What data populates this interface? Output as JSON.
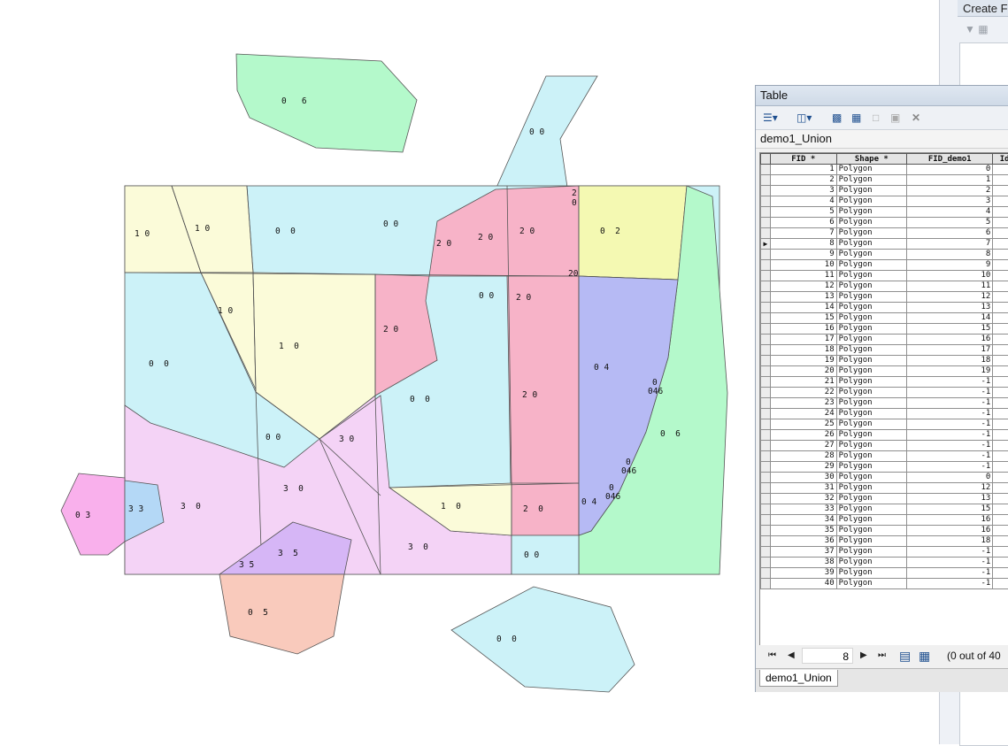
{
  "create_features": {
    "title": "Create Features"
  },
  "table_window": {
    "title": "Table",
    "table_name": "demo1_Union",
    "columns": [
      "FID *",
      "Shape *",
      "FID_demo1",
      "Id"
    ],
    "current_row": 8,
    "rows": [
      {
        "fid": "1",
        "shape": "Polygon",
        "fid_demo1": "0"
      },
      {
        "fid": "2",
        "shape": "Polygon",
        "fid_demo1": "1"
      },
      {
        "fid": "3",
        "shape": "Polygon",
        "fid_demo1": "2"
      },
      {
        "fid": "4",
        "shape": "Polygon",
        "fid_demo1": "3"
      },
      {
        "fid": "5",
        "shape": "Polygon",
        "fid_demo1": "4"
      },
      {
        "fid": "6",
        "shape": "Polygon",
        "fid_demo1": "5"
      },
      {
        "fid": "7",
        "shape": "Polygon",
        "fid_demo1": "6"
      },
      {
        "fid": "8",
        "shape": "Polygon",
        "fid_demo1": "7"
      },
      {
        "fid": "9",
        "shape": "Polygon",
        "fid_demo1": "8"
      },
      {
        "fid": "10",
        "shape": "Polygon",
        "fid_demo1": "9"
      },
      {
        "fid": "11",
        "shape": "Polygon",
        "fid_demo1": "10"
      },
      {
        "fid": "12",
        "shape": "Polygon",
        "fid_demo1": "11"
      },
      {
        "fid": "13",
        "shape": "Polygon",
        "fid_demo1": "12"
      },
      {
        "fid": "14",
        "shape": "Polygon",
        "fid_demo1": "13"
      },
      {
        "fid": "15",
        "shape": "Polygon",
        "fid_demo1": "14"
      },
      {
        "fid": "16",
        "shape": "Polygon",
        "fid_demo1": "15"
      },
      {
        "fid": "17",
        "shape": "Polygon",
        "fid_demo1": "16"
      },
      {
        "fid": "18",
        "shape": "Polygon",
        "fid_demo1": "17"
      },
      {
        "fid": "19",
        "shape": "Polygon",
        "fid_demo1": "18"
      },
      {
        "fid": "20",
        "shape": "Polygon",
        "fid_demo1": "19"
      },
      {
        "fid": "21",
        "shape": "Polygon",
        "fid_demo1": "-1"
      },
      {
        "fid": "22",
        "shape": "Polygon",
        "fid_demo1": "-1"
      },
      {
        "fid": "23",
        "shape": "Polygon",
        "fid_demo1": "-1"
      },
      {
        "fid": "24",
        "shape": "Polygon",
        "fid_demo1": "-1"
      },
      {
        "fid": "25",
        "shape": "Polygon",
        "fid_demo1": "-1"
      },
      {
        "fid": "26",
        "shape": "Polygon",
        "fid_demo1": "-1"
      },
      {
        "fid": "27",
        "shape": "Polygon",
        "fid_demo1": "-1"
      },
      {
        "fid": "28",
        "shape": "Polygon",
        "fid_demo1": "-1"
      },
      {
        "fid": "29",
        "shape": "Polygon",
        "fid_demo1": "-1"
      },
      {
        "fid": "30",
        "shape": "Polygon",
        "fid_demo1": "0"
      },
      {
        "fid": "31",
        "shape": "Polygon",
        "fid_demo1": "12"
      },
      {
        "fid": "32",
        "shape": "Polygon",
        "fid_demo1": "13"
      },
      {
        "fid": "33",
        "shape": "Polygon",
        "fid_demo1": "15"
      },
      {
        "fid": "34",
        "shape": "Polygon",
        "fid_demo1": "16"
      },
      {
        "fid": "35",
        "shape": "Polygon",
        "fid_demo1": "16"
      },
      {
        "fid": "36",
        "shape": "Polygon",
        "fid_demo1": "18"
      },
      {
        "fid": "37",
        "shape": "Polygon",
        "fid_demo1": "-1"
      },
      {
        "fid": "38",
        "shape": "Polygon",
        "fid_demo1": "-1"
      },
      {
        "fid": "39",
        "shape": "Polygon",
        "fid_demo1": "-1"
      },
      {
        "fid": "40",
        "shape": "Polygon",
        "fid_demo1": "-1"
      }
    ],
    "nav": {
      "page_value": "8",
      "status": "(0 out of 40"
    },
    "tab_label": "demo1_Union"
  },
  "map": {
    "colors": {
      "cyan": "#ccf2f8",
      "pink": "#f7b3c8",
      "yellow": "#fbfbd9",
      "lime": "#f4f9b2",
      "green": "#b4f9cb",
      "blue": "#b6baf4",
      "lavender": "#f4d3f6",
      "magenta": "#f9b0ec",
      "lightblue": "#b4d8f6",
      "purple": "#d6b6f6",
      "salmon": "#f9cabc",
      "outline": "#555555"
    },
    "labels": [
      "0   6",
      "0 0",
      "2\n0",
      "1 0",
      "1 0",
      "0  0",
      "0 0",
      "2 0",
      "2 0",
      "2 0",
      "0  2",
      "20",
      "0 0",
      "2 0",
      "1 0",
      "1  0",
      "2 0",
      "0 4",
      "0",
      "046",
      "0  0",
      "0  0",
      "0  6",
      "2 0",
      "0 0",
      "3 0",
      "0",
      "046",
      "3  0",
      "3  0",
      "3 3",
      "0 3",
      "0",
      "046",
      "1  0",
      "2  0",
      "0 4",
      "3  5",
      "3  0",
      "0 0",
      "3 5",
      "0  5",
      "0  0"
    ]
  }
}
